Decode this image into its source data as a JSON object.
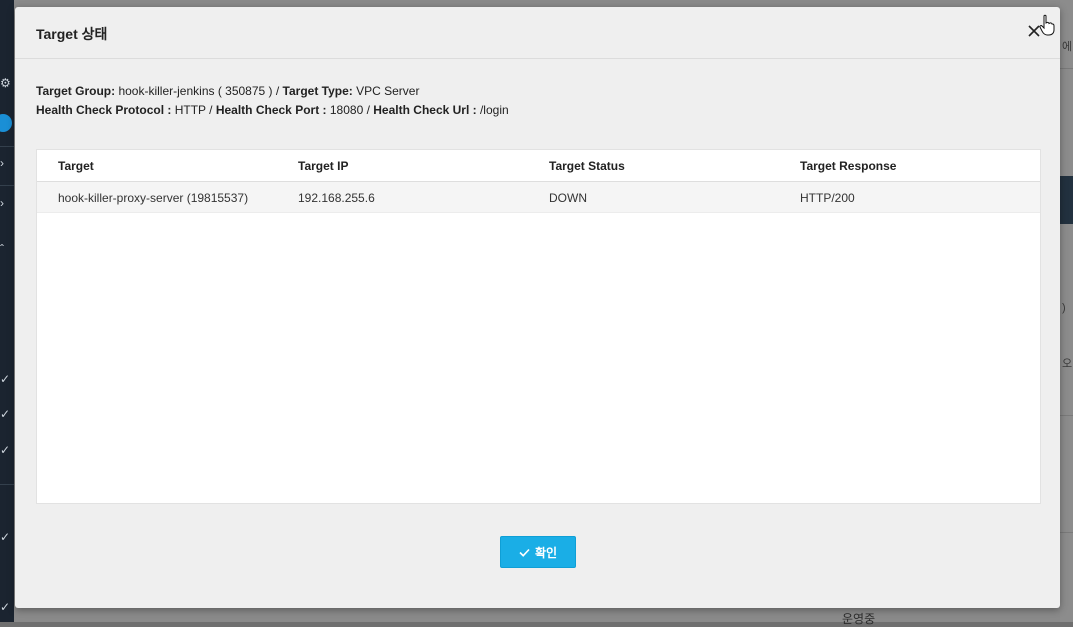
{
  "modal": {
    "title": "Target 상태",
    "info": {
      "target_group_label": "Target Group:",
      "target_group_value": "hook-killer-jenkins ( 350875 ) /",
      "target_type_label": "Target Type:",
      "target_type_value": "VPC Server",
      "hc_protocol_label": "Health Check Protocol :",
      "hc_protocol_value": "HTTP /",
      "hc_port_label": "Health Check Port :",
      "hc_port_value": "18080 /",
      "hc_url_label": "Health Check Url :",
      "hc_url_value": "/login"
    },
    "table": {
      "headers": [
        "Target",
        "Target IP",
        "Target Status",
        "Target Response"
      ],
      "rows": [
        [
          "hook-killer-proxy-server (19815537)",
          "192.168.255.6",
          "DOWN",
          "HTTP/200"
        ]
      ]
    },
    "confirm_label": "확인"
  },
  "background": {
    "right_text_1": "에",
    "right_text_2": ")",
    "right_text_3": "오",
    "bottom_text": "운영중"
  },
  "colors": {
    "accent": "#1aaee6",
    "sidebar": "#1b2430"
  },
  "icons": [
    "close-icon",
    "check-icon",
    "hand-cursor-icon"
  ]
}
